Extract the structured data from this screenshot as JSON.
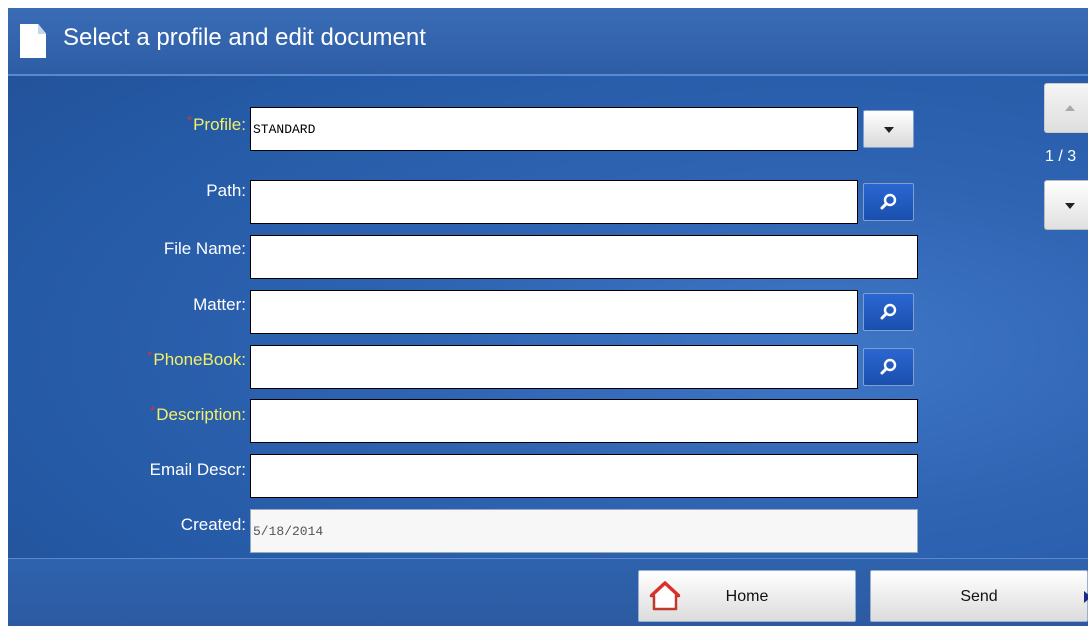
{
  "header": {
    "title": "Select a profile and edit document",
    "icon": "document-icon"
  },
  "form": {
    "profile": {
      "label": "Profile:",
      "required": true,
      "value": "STANDARD"
    },
    "path": {
      "label": "Path:",
      "required": false,
      "value": ""
    },
    "file_name": {
      "label": "File Name:",
      "required": false,
      "value": ""
    },
    "matter": {
      "label": "Matter:",
      "required": false,
      "value": ""
    },
    "phonebook": {
      "label": "PhoneBook:",
      "required": true,
      "value": ""
    },
    "description": {
      "label": "Description:",
      "required": true,
      "value": ""
    },
    "email_descr": {
      "label": "Email Descr:",
      "required": false,
      "value": ""
    },
    "created": {
      "label": "Created:",
      "required": false,
      "value": "5/18/2014"
    }
  },
  "required_marker": "*",
  "pager": {
    "text": "1 / 3"
  },
  "footer": {
    "home_label": "Home",
    "send_label": "Send"
  },
  "colors": {
    "background": "#2f64b3",
    "required_label": "#f3ef6a",
    "search_button": "#1a4fae"
  }
}
